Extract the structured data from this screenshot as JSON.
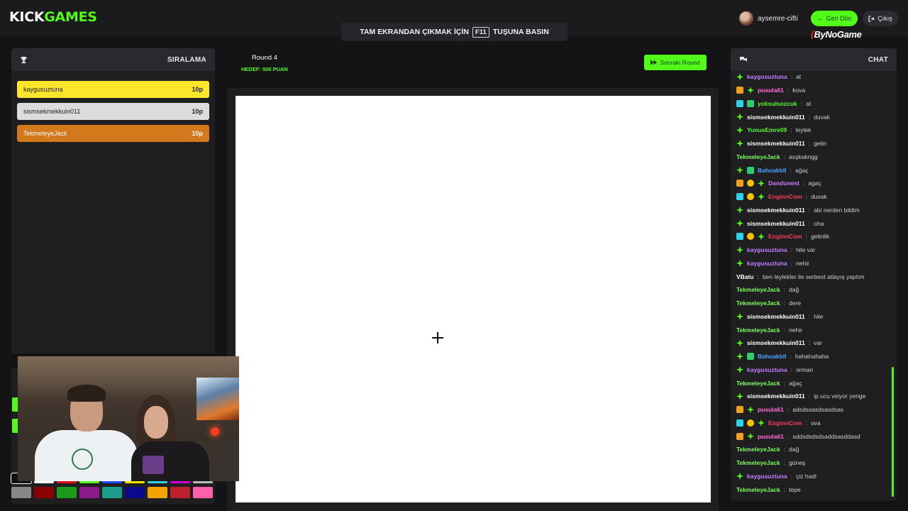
{
  "header": {
    "logo_kick": "KICK",
    "logo_games": "GAMES",
    "fullscreen_before": "TAM EKRANDAN ÇIKMAK İÇİN",
    "fullscreen_key": "F11",
    "fullscreen_after": "TUŞUNA BASIN",
    "username": "aysemre-cifti",
    "back_label": "Geri Dön",
    "exit_label": "Çıkış",
    "sponsor": "ByNoGame"
  },
  "leaderboard": {
    "title": "SIRALAMA",
    "rows": [
      {
        "name": "kaygusuztuna",
        "score": "10p",
        "color": "#fce52a"
      },
      {
        "name": "sismsekmekkuin011",
        "score": "10p",
        "color": "#dcdcdc"
      },
      {
        "name": "TekmeleyeJack",
        "score": "10p",
        "color": "#d4781c"
      }
    ]
  },
  "game": {
    "round_label": "Round 4",
    "target_label": "HEDEF: 500 PUAN",
    "next_round_label": "Sonraki Round"
  },
  "palette": [
    "#888888",
    "#8b0000",
    "#1a9c1a",
    "#8b1a8b",
    "#1a9c8c",
    "#0a0a8b",
    "#f5a300",
    "#c0202c",
    "#ff5fa8"
  ],
  "palette_top": [
    "#111111",
    "#ffffff",
    "#e01010",
    "#53fc18",
    "#1a4cff",
    "#f5e000",
    "#2dd4e8",
    "#d000d0",
    "#bbbbbb"
  ],
  "chat": {
    "title": "CHAT",
    "messages": [
      {
        "badges": [
          "sub"
        ],
        "user": "kaygusuztuna",
        "color": "#c77dff",
        "text": "at"
      },
      {
        "badges": [
          "crown",
          "sub"
        ],
        "user": "pusula61",
        "color": "#ff6fd8",
        "text": "kova"
      },
      {
        "badges": [
          "game",
          "gift"
        ],
        "user": "yoksulsozcuk",
        "color": "#53fc18",
        "text": "at"
      },
      {
        "badges": [
          "sub"
        ],
        "user": "sismsekmekkuin011",
        "color": "#ffffff",
        "text": "duvak"
      },
      {
        "badges": [
          "sub"
        ],
        "user": "YunusEmre09",
        "color": "#53fc18",
        "text": "leylek"
      },
      {
        "badges": [
          "sub"
        ],
        "user": "sismsekmekkuin011",
        "color": "#ffffff",
        "text": "gelin"
      },
      {
        "badges": [],
        "user": "TekmeleyeJack",
        "color": "#7dff5a",
        "text": "asşkakngg"
      },
      {
        "badges": [
          "sub",
          "gift"
        ],
        "user": "Bahoakbll",
        "color": "#4aa3ff",
        "text": "ağaç"
      },
      {
        "badges": [
          "crown",
          "coin",
          "sub"
        ],
        "user": "Dandunest",
        "color": "#c77dff",
        "text": "agaç"
      },
      {
        "badges": [
          "game",
          "coin",
          "sub"
        ],
        "user": "EnginnCom",
        "color": "#ff3b5c",
        "text": "duvak"
      },
      {
        "badges": [
          "sub"
        ],
        "user": "sismsekmekkuin011",
        "color": "#ffffff",
        "text": "abi nerden bildim"
      },
      {
        "badges": [
          "sub"
        ],
        "user": "sismsekmekkuin011",
        "color": "#ffffff",
        "text": "oha"
      },
      {
        "badges": [
          "game",
          "coin",
          "sub"
        ],
        "user": "EnginnCom",
        "color": "#ff3b5c",
        "text": "gelinlik"
      },
      {
        "badges": [
          "sub"
        ],
        "user": "kaygusuztuna",
        "color": "#c77dff",
        "text": "hile var"
      },
      {
        "badges": [
          "sub"
        ],
        "user": "kaygusuztuna",
        "color": "#c77dff",
        "text": "nehir"
      },
      {
        "badges": [],
        "user": "VBatu",
        "color": "#ffffff",
        "text": "ben leylekler ile serbest atlayış yaptım"
      },
      {
        "badges": [],
        "user": "TekmeleyeJack",
        "color": "#7dff5a",
        "text": "dağ"
      },
      {
        "badges": [],
        "user": "TekmeleyeJack",
        "color": "#7dff5a",
        "text": "dere"
      },
      {
        "badges": [
          "sub"
        ],
        "user": "sismsekmekkuin011",
        "color": "#ffffff",
        "text": "hile"
      },
      {
        "badges": [],
        "user": "TekmeleyeJack",
        "color": "#7dff5a",
        "text": "nehir"
      },
      {
        "badges": [
          "sub"
        ],
        "user": "sismsekmekkuin011",
        "color": "#ffffff",
        "text": "var"
      },
      {
        "badges": [
          "sub",
          "gift"
        ],
        "user": "Bahoakbll",
        "color": "#4aa3ff",
        "text": "hahahahaha"
      },
      {
        "badges": [
          "sub"
        ],
        "user": "kaygusuztuna",
        "color": "#c77dff",
        "text": "orman"
      },
      {
        "badges": [],
        "user": "TekmeleyeJack",
        "color": "#7dff5a",
        "text": "ağaç"
      },
      {
        "badges": [
          "sub"
        ],
        "user": "sismsekmekkuin011",
        "color": "#ffffff",
        "text": "ip ucu veiyor yenge"
      },
      {
        "badges": [
          "crown",
          "sub"
        ],
        "user": "pusula61",
        "color": "#ff6fd8",
        "text": "adsdssasdsasdsas"
      },
      {
        "badges": [
          "game",
          "coin",
          "sub"
        ],
        "user": "EnginnCom",
        "color": "#ff3b5c",
        "text": "ova"
      },
      {
        "badges": [
          "crown",
          "sub"
        ],
        "user": "pusula61",
        "color": "#ff6fd8",
        "text": "sddsdsdsdsaddsasddasd"
      },
      {
        "badges": [],
        "user": "TekmeleyeJack",
        "color": "#7dff5a",
        "text": "dağ"
      },
      {
        "badges": [],
        "user": "TekmeleyeJack",
        "color": "#7dff5a",
        "text": "güneş"
      },
      {
        "badges": [
          "sub"
        ],
        "user": "kaygusuztuna",
        "color": "#c77dff",
        "text": "çiz hadi"
      },
      {
        "badges": [],
        "user": "TekmeleyeJack",
        "color": "#7dff5a",
        "text": "tepe"
      }
    ]
  }
}
